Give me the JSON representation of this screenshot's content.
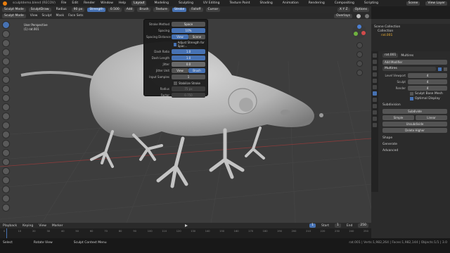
{
  "menubar": {
    "file_title": "sculptdemo.blend (RECOV)",
    "menus": [
      "File",
      "Edit",
      "Render",
      "Window",
      "Help"
    ],
    "workspaces": [
      "Layout",
      "Modeling",
      "Sculpting",
      "UV Editing",
      "Texture Paint",
      "Shading",
      "Animation",
      "Rendering",
      "Compositing",
      "Scripting"
    ],
    "active_workspace": "Layout",
    "scene_label": "Scene",
    "view_layer_label": "View Layer"
  },
  "tool_header": {
    "brush_name": "SculptDraw",
    "radius_label": "Radius",
    "radius_value": "90 px",
    "strength_label": "Strength",
    "strength_value": "0.500",
    "mode": "Add",
    "brush_menu": "Brush",
    "texture_menu": "Texture",
    "stroke_menu": "Stroke",
    "falloff_menu": "Falloff",
    "cursor_menu": "Cursor",
    "symmetry_label": "X Y Z",
    "options_menu": "Options"
  },
  "view_header": {
    "mode": "Sculpt Mode",
    "menus": [
      "View",
      "Sculpt",
      "Mask",
      "Face Sets"
    ],
    "overlay_label": "Overlays"
  },
  "viewport": {
    "view_name": "User Perspective",
    "object_name": "(1) rat.001"
  },
  "stroke_popover": {
    "stroke_method_label": "Stroke Method",
    "stroke_method_value": "Space",
    "spacing_label": "Spacing",
    "spacing_value": "10%",
    "spacing_distance_label": "Spacing Distance",
    "spacing_distance_options": [
      "View",
      "Scene"
    ],
    "adjust_strength_label": "Adjust Strength for Spac...",
    "dash_ratio_label": "Dash Ratio",
    "dash_ratio_value": "1.0",
    "dash_length_label": "Dash Length",
    "dash_length_value": "1.0",
    "jitter_label": "Jitter",
    "jitter_value": "0.0",
    "jitter_unit_label": "Jitter Unit",
    "jitter_unit_options": [
      "View",
      "Brush"
    ],
    "input_samples_label": "Input Samples",
    "input_samples_value": "1",
    "stabilize_label": "Stabilize Stroke",
    "radius_label": "Radius",
    "radius_value": "75 px",
    "factor_label": "Factor",
    "factor_value": "0.750"
  },
  "timeline": {
    "menus": [
      "Playback",
      "Keying",
      "View",
      "Marker"
    ],
    "current_frame": "1",
    "start_label": "Start",
    "start_value": "1",
    "end_label": "End",
    "end_value": "250",
    "ticks": [
      "0",
      "10",
      "20",
      "30",
      "40",
      "50",
      "60",
      "70",
      "80",
      "90",
      "100",
      "110",
      "120",
      "130",
      "140",
      "150",
      "160",
      "170",
      "180",
      "190",
      "200",
      "210",
      "220",
      "230",
      "240",
      "250"
    ]
  },
  "outliner": {
    "items": [
      "Scene Collection",
      "Collection",
      "rat.001"
    ]
  },
  "properties": {
    "object_name": "rat.001",
    "modifier_tab": "Multires",
    "add_modifier_label": "Add Modifier",
    "modifier_name": "Multires",
    "level_viewport_label": "Level Viewport",
    "level_viewport_value": "4",
    "sculpt_label": "Sculpt",
    "sculpt_value": "4",
    "render_label": "Render",
    "render_value": "4",
    "sculpt_base_mesh_label": "Sculpt Base Mesh",
    "optimal_display_label": "Optimal Display",
    "subdivision_header": "Subdivision",
    "subdivide_label": "Subdivide",
    "simple_label": "Simple",
    "linear_label": "Linear",
    "unsubdivide_label": "Unsubdivide",
    "delete_higher_label": "Delete Higher",
    "shape_header": "Shape",
    "generate_header": "Generate",
    "advanced_header": "Advanced"
  },
  "statusbar": {
    "items": [
      "Select",
      "Rotate View",
      "Sculpt Context Menu"
    ],
    "stats": "rat.001 | Verts:1,982,264 | Faces:1,982,144 | Objects:1/1 | 3.0"
  }
}
